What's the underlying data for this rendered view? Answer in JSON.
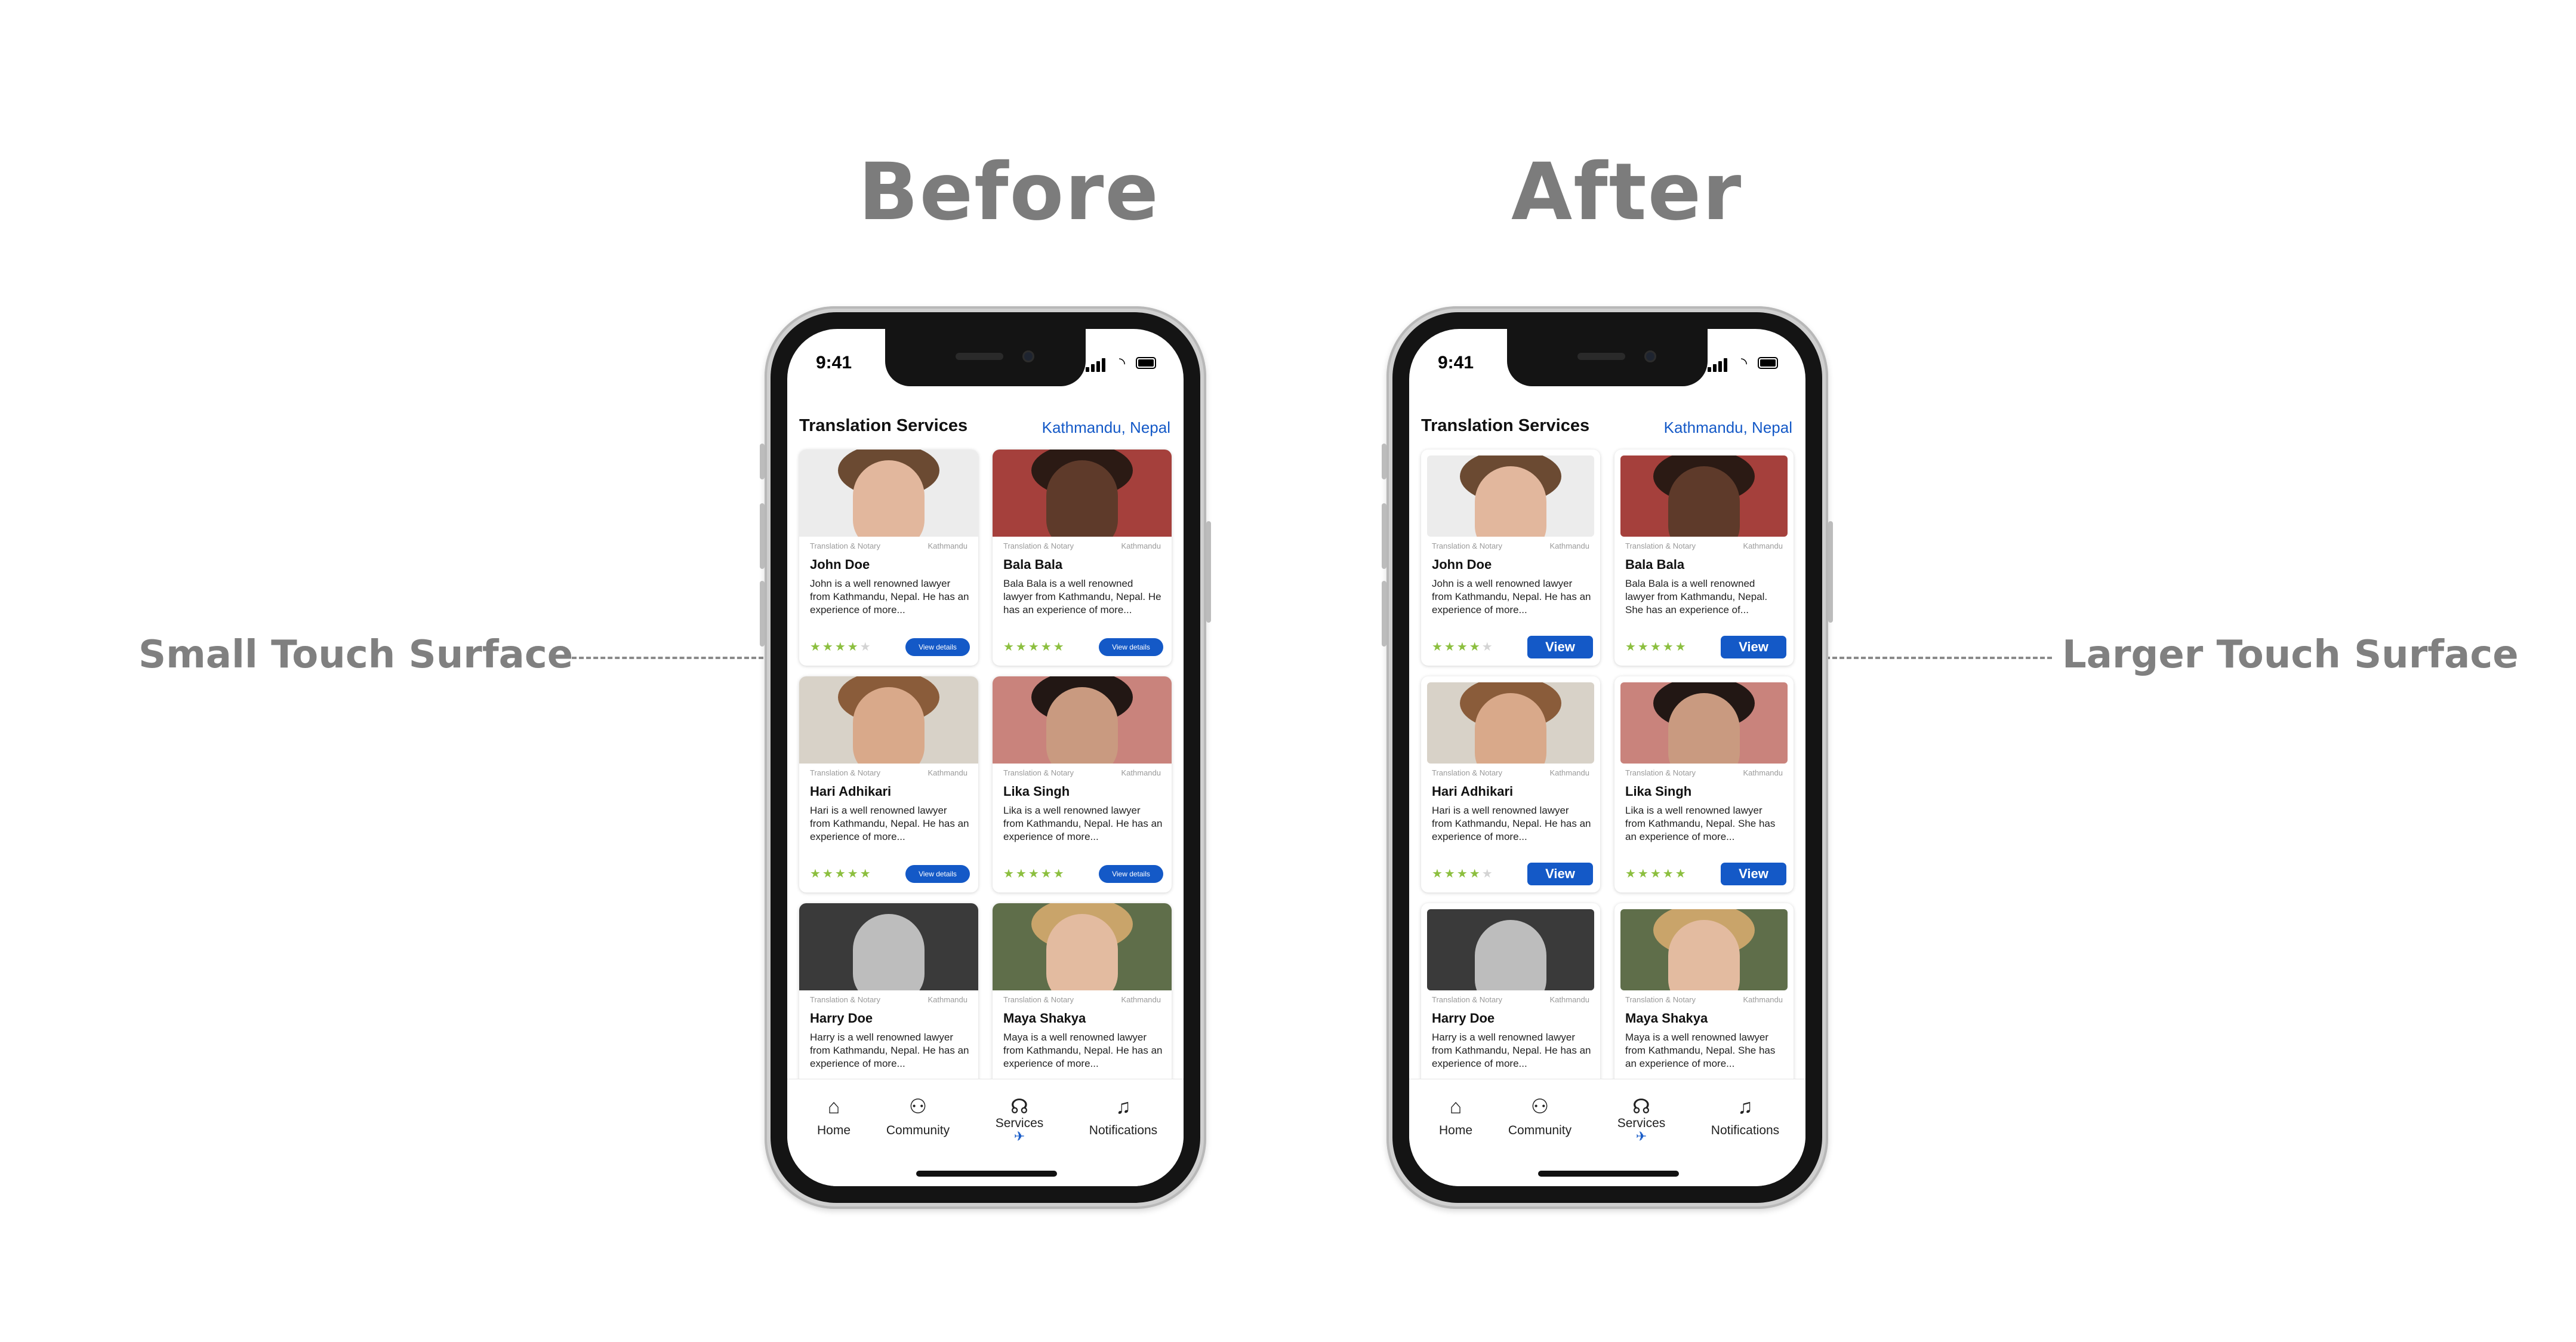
{
  "headings": {
    "before": "Before",
    "after": "After"
  },
  "side_labels": {
    "left": "Small Touch Surface",
    "right": "Larger Touch Surface"
  },
  "status": {
    "time": "9:41"
  },
  "header": {
    "title": "Translation Services",
    "location": "Kathmandu, Nepal"
  },
  "card_meta": {
    "category": "Translation & Notary",
    "location": "Kathmandu"
  },
  "cards": [
    {
      "name": "John Doe",
      "desc": "John is a well renowned lawyer from Kathmandu, Nepal. He has an experience of more...",
      "stars": "★★★★",
      "stars_off": "★",
      "rating": 4
    },
    {
      "name": "Bala Bala",
      "desc": "Bala Bala is a well renowned lawyer from Kathmandu, Nepal. He has an experience of more...",
      "desc_after": "Bala Bala is a well renowned lawyer from Kathmandu, Nepal. She has an experience of...",
      "stars": "★★★★★",
      "stars_off": "",
      "rating": 5
    },
    {
      "name": "Hari Adhikari",
      "desc": "Hari is a well renowned lawyer from Kathmandu, Nepal. He has an experience of more...",
      "stars": "★★★★★",
      "stars_off": "",
      "stars_after": "★★★★",
      "stars_off_after": "★",
      "rating": 5,
      "rating_after": 4
    },
    {
      "name": "Lika Singh",
      "desc": "Lika is a well renowned lawyer from Kathmandu, Nepal. He has an experience of more...",
      "desc_after": "Lika is a well renowned lawyer from Kathmandu, Nepal. She has an experience of more...",
      "stars": "★★★★★",
      "stars_off": "",
      "rating": 5
    },
    {
      "name": "Harry Doe",
      "desc": "Harry is a well renowned lawyer from Kathmandu, Nepal. He has an experience of more..."
    },
    {
      "name": "Maya Shakya",
      "desc": "Maya is a well renowned lawyer from Kathmandu, Nepal. He has an experience of more...",
      "desc_after": "Maya is a well renowned lawyer from Kathmandu, Nepal. She has an experience of more..."
    }
  ],
  "buttons": {
    "before": "View details",
    "after": "View"
  },
  "tabs": [
    {
      "label": "Home",
      "icon": "home-icon"
    },
    {
      "label": "Community",
      "icon": "community-icon"
    },
    {
      "label": "Services",
      "icon": "services-icon",
      "active": true
    },
    {
      "label": "Notifications",
      "icon": "bell-icon"
    }
  ],
  "colors": {
    "accent": "#1459c7",
    "star": "#8cbf3f",
    "heading": "#7c7c7c"
  }
}
